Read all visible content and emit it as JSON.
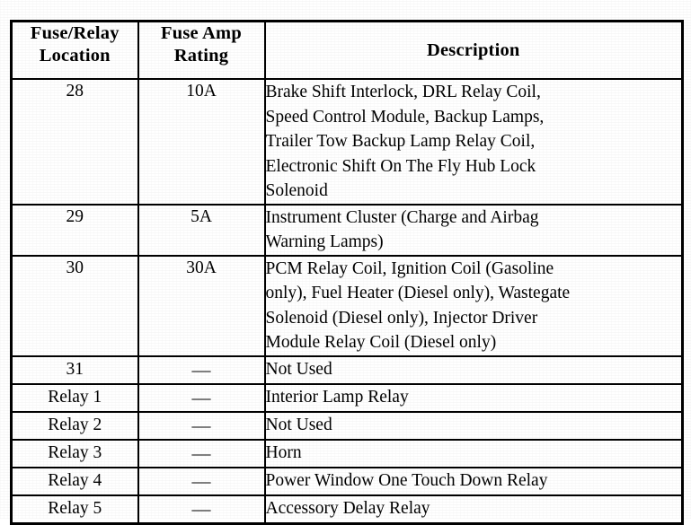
{
  "table": {
    "columns": [
      {
        "id": "location",
        "header_lines": [
          "Fuse/Relay",
          "Location"
        ]
      },
      {
        "id": "amp_rating",
        "header_lines": [
          "Fuse Amp",
          "Rating"
        ]
      },
      {
        "id": "description",
        "header_lines": [
          "Description"
        ]
      }
    ],
    "rows": [
      {
        "location": "28",
        "amp_rating": "10A",
        "description_lines": [
          "Brake Shift Interlock, DRL Relay Coil,",
          "Speed Control Module, Backup Lamps,",
          "Trailer Tow Backup Lamp Relay Coil,",
          "Electronic Shift On The Fly Hub Lock",
          "Solenoid"
        ]
      },
      {
        "location": "29",
        "amp_rating": "5A",
        "description_lines": [
          "Instrument Cluster (Charge and Airbag",
          "Warning Lamps)"
        ]
      },
      {
        "location": "30",
        "amp_rating": "30A",
        "description_lines": [
          "PCM Relay Coil, Ignition Coil (Gasoline",
          "only), Fuel Heater (Diesel only), Wastegate",
          "Solenoid (Diesel only), Injector Driver",
          "Module Relay Coil (Diesel only)"
        ]
      },
      {
        "location": "31",
        "amp_rating": "—",
        "description_lines": [
          "Not Used"
        ]
      },
      {
        "location": "Relay 1",
        "amp_rating": "—",
        "description_lines": [
          "Interior Lamp Relay"
        ]
      },
      {
        "location": "Relay 2",
        "amp_rating": "—",
        "description_lines": [
          "Not Used"
        ]
      },
      {
        "location": "Relay 3",
        "amp_rating": "—",
        "description_lines": [
          "Horn"
        ]
      },
      {
        "location": "Relay 4",
        "amp_rating": "—",
        "description_lines": [
          "Power Window One Touch Down Relay"
        ]
      },
      {
        "location": "Relay 5",
        "amp_rating": "—",
        "description_lines": [
          "Accessory Delay Relay"
        ]
      }
    ]
  }
}
